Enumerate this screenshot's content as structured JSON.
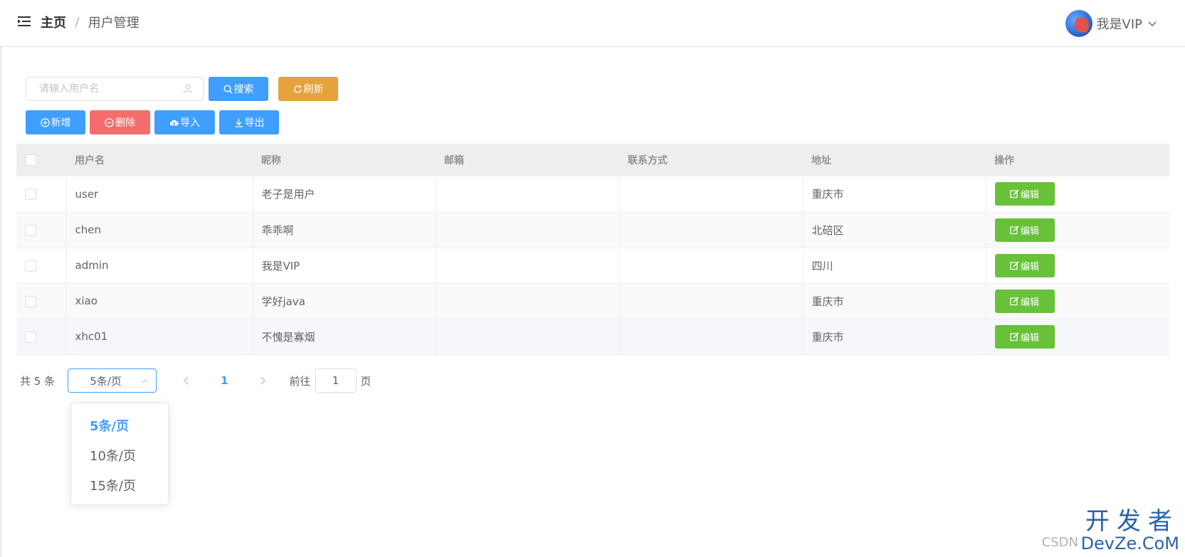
{
  "header": {
    "breadcrumb_home": "主页",
    "breadcrumb_separator": "/",
    "breadcrumb_current": "用户管理",
    "user_name": "我是VIP"
  },
  "toolbar": {
    "search_placeholder": "请输入用户名",
    "search_label": "搜索",
    "refresh_label": "刷新",
    "add_label": "新增",
    "delete_label": "删除",
    "import_label": "导入",
    "export_label": "导出"
  },
  "table": {
    "columns": [
      "用户名",
      "昵称",
      "邮箱",
      "联系方式",
      "地址",
      "操作"
    ],
    "rows": [
      {
        "username": "user",
        "nickname": "老子是用户",
        "email": "",
        "phone": "",
        "address": "重庆市"
      },
      {
        "username": "chen",
        "nickname": "乖乖啊",
        "email": "",
        "phone": "",
        "address": "北碚区"
      },
      {
        "username": "admin",
        "nickname": "我是VIP",
        "email": "",
        "phone": "",
        "address": "四川"
      },
      {
        "username": "xiao",
        "nickname": "学好java",
        "email": "",
        "phone": "",
        "address": "重庆市"
      },
      {
        "username": "xhc01",
        "nickname": "不愧是寡烟",
        "email": "",
        "phone": "",
        "address": "重庆市"
      }
    ],
    "edit_label": "编辑"
  },
  "pagination": {
    "total_text": "共 5 条",
    "page_size_value": "5条/页",
    "current_page": "1",
    "goto_prefix": "前往",
    "goto_value": "1",
    "goto_suffix": "页",
    "size_options": [
      "5条/页",
      "10条/页",
      "15条/页"
    ]
  },
  "watermark": {
    "main": "开发者",
    "sub": "DevZe.CoM",
    "csdn": "CSDN"
  },
  "colors": {
    "primary": "#409eff",
    "warning": "#e6a23c",
    "danger": "#f56c6c",
    "success": "#67c23a"
  }
}
